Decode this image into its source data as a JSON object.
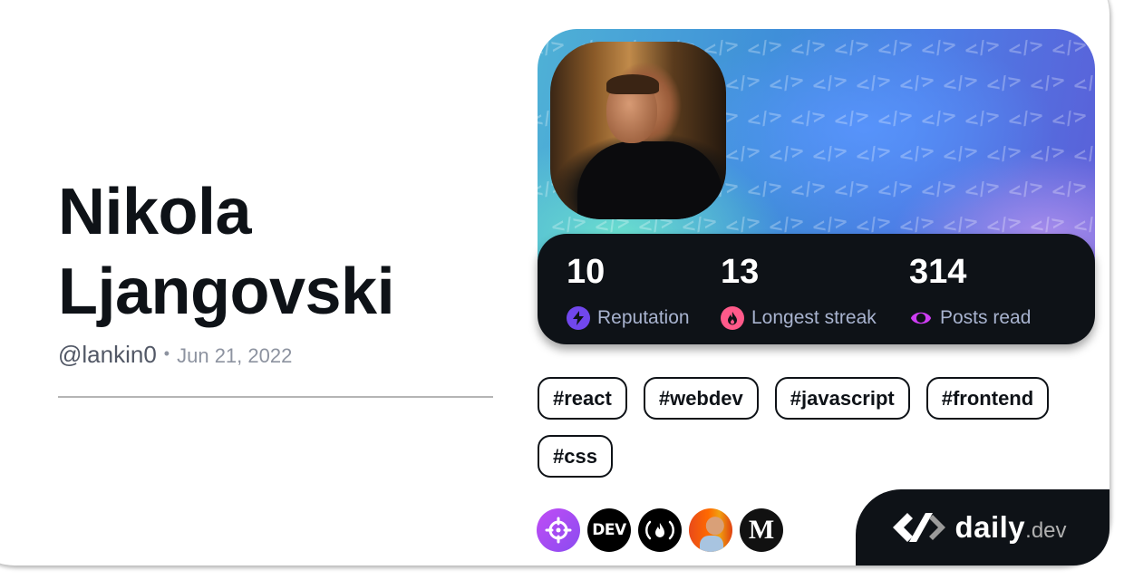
{
  "profile": {
    "first_name": "Nikola",
    "last_name": "Ljangovski",
    "handle": "@lankin0",
    "separator": "•",
    "joined_date": "Jun 21, 2022",
    "avatar_icon": "profile-photo"
  },
  "stats": [
    {
      "value": "10",
      "label": "Reputation",
      "icon": "lightning-icon",
      "color": "#7147ed"
    },
    {
      "value": "13",
      "label": "Longest streak",
      "icon": "flame-icon",
      "color": "#ff5a8a"
    },
    {
      "value": "314",
      "label": "Posts read",
      "icon": "eye-ring-icon",
      "color": "#ce3df3"
    }
  ],
  "tags": [
    "#react",
    "#webdev",
    "#javascript",
    "#frontend",
    "#css"
  ],
  "sources": [
    {
      "name": "crosshair-source",
      "icon": "crosshair-icon",
      "color": "#a24cf2"
    },
    {
      "name": "dev-to-source",
      "label": "DEV",
      "color": "#000000"
    },
    {
      "name": "freecodecamp-source",
      "label": "(🔥)",
      "color": "#000000"
    },
    {
      "name": "person-source",
      "icon": "person-avatar",
      "color": "#f05a14"
    },
    {
      "name": "medium-source",
      "label": "M",
      "color": "#111111"
    }
  ],
  "brand": {
    "word": "daily",
    "tld": ".dev"
  },
  "colors": {
    "text_primary": "#0e1217",
    "stats_bg": "#0e1217",
    "stats_label": "#a8b3cf"
  }
}
